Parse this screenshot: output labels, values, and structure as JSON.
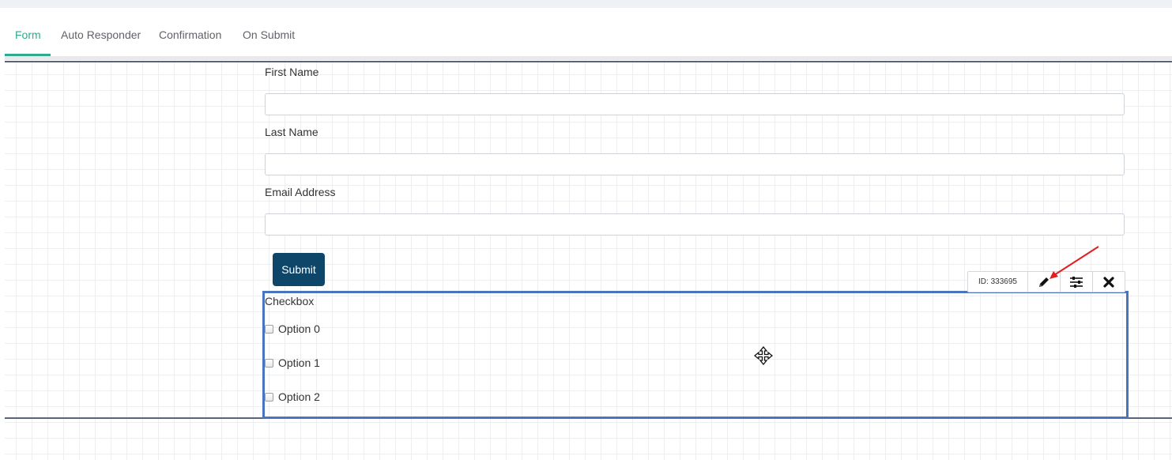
{
  "tabs": [
    {
      "label": "Form",
      "active": true
    },
    {
      "label": "Auto Responder",
      "active": false
    },
    {
      "label": "Confirmation",
      "active": false
    },
    {
      "label": "On Submit",
      "active": false
    }
  ],
  "form": {
    "fields": [
      {
        "label": "First Name",
        "value": "",
        "placeholder": ""
      },
      {
        "label": "Last Name",
        "value": "",
        "placeholder": ""
      },
      {
        "label": "Email Address",
        "value": "",
        "placeholder": ""
      }
    ],
    "submit_label": "Submit"
  },
  "checkbox_block": {
    "title": "Checkbox",
    "options": [
      "Option 0",
      "Option 1",
      "Option 2"
    ]
  },
  "element_toolbar": {
    "id_label": "ID: 333695",
    "buttons": [
      "pencil-icon",
      "sliders-icon",
      "close-icon"
    ]
  },
  "colors": {
    "accent_tab": "#2fa98f",
    "submit_bg": "#0d4668",
    "selection_border": "#4a74bd",
    "annotation_arrow": "#e02020"
  }
}
